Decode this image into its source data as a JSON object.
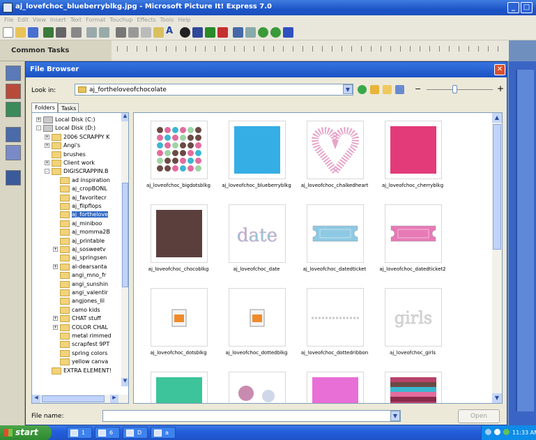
{
  "app": {
    "title": "aj_lovefchoc_blueberryblkg.jpg - Microsoft Picture It! Express 7.0",
    "menu": [
      "File",
      "Edit",
      "View",
      "Insert",
      "Text",
      "Format",
      "Touchup",
      "Effects",
      "Tools",
      "Help"
    ],
    "common_tasks": "Common Tasks"
  },
  "browser": {
    "title": "File Browser",
    "lookin_label": "Look in:",
    "lookin_value": "aj_fortheloveofchocolate",
    "tabs": [
      "Folders",
      "Tasks"
    ],
    "tree": [
      {
        "label": "Local Disk (C:)",
        "level": 0,
        "expander": "+",
        "kind": "drive"
      },
      {
        "label": "Local Disk (D:)",
        "level": 0,
        "expander": "-",
        "kind": "drive"
      },
      {
        "label": "2006 SCRAPPY K",
        "level": 1,
        "expander": "+",
        "kind": "folder"
      },
      {
        "label": "Angi's",
        "level": 1,
        "expander": "+",
        "kind": "folder"
      },
      {
        "label": "brushes",
        "level": 1,
        "expander": "",
        "kind": "folder"
      },
      {
        "label": "Client work",
        "level": 1,
        "expander": "+",
        "kind": "folder"
      },
      {
        "label": "DIGISCRAPPIN.B",
        "level": 1,
        "expander": "-",
        "kind": "folder"
      },
      {
        "label": "ad inspiration",
        "level": 2,
        "expander": "",
        "kind": "folder"
      },
      {
        "label": "aj_cropBONL",
        "level": 2,
        "expander": "",
        "kind": "folder"
      },
      {
        "label": "aj_favoritecr",
        "level": 2,
        "expander": "",
        "kind": "folder"
      },
      {
        "label": "aj_flipflops",
        "level": 2,
        "expander": "",
        "kind": "folder"
      },
      {
        "label": "aj_forthelove",
        "level": 2,
        "expander": "",
        "kind": "folder",
        "selected": true
      },
      {
        "label": "aj_miniboo",
        "level": 2,
        "expander": "",
        "kind": "folder"
      },
      {
        "label": "aj_momma2B",
        "level": 2,
        "expander": "",
        "kind": "folder"
      },
      {
        "label": "aj_printable",
        "level": 2,
        "expander": "",
        "kind": "folder"
      },
      {
        "label": "aj_sosweetv",
        "level": 2,
        "expander": "+",
        "kind": "folder"
      },
      {
        "label": "aj_springsen",
        "level": 2,
        "expander": "",
        "kind": "folder"
      },
      {
        "label": "al-dearsanta",
        "level": 2,
        "expander": "+",
        "kind": "folder"
      },
      {
        "label": "angi_mno_fr",
        "level": 2,
        "expander": "",
        "kind": "folder"
      },
      {
        "label": "angi_sunshin",
        "level": 2,
        "expander": "",
        "kind": "folder"
      },
      {
        "label": "angi_valentir",
        "level": 2,
        "expander": "",
        "kind": "folder"
      },
      {
        "label": "angjones_lil",
        "level": 2,
        "expander": "",
        "kind": "folder"
      },
      {
        "label": "camo kids",
        "level": 2,
        "expander": "",
        "kind": "folder"
      },
      {
        "label": "CHAT stuff",
        "level": 2,
        "expander": "+",
        "kind": "folder"
      },
      {
        "label": "COLOR CHAL",
        "level": 2,
        "expander": "+",
        "kind": "folder"
      },
      {
        "label": "metal rimmed",
        "level": 2,
        "expander": "",
        "kind": "folder"
      },
      {
        "label": "scrapfest 9PT",
        "level": 2,
        "expander": "",
        "kind": "folder"
      },
      {
        "label": "spring colors",
        "level": 2,
        "expander": "",
        "kind": "folder"
      },
      {
        "label": "yellow canva",
        "level": 2,
        "expander": "",
        "kind": "folder"
      },
      {
        "label": "EXTRA ELEMENT!",
        "level": 1,
        "expander": "",
        "kind": "folder"
      }
    ],
    "files": [
      {
        "name": "aj_loveofchoc_bigdotsblkg",
        "thumb": "polka",
        "color": "#6b4a45"
      },
      {
        "name": "aj_loveofchoc_blueberryblkg",
        "thumb": "solid",
        "color": "#35aee6"
      },
      {
        "name": "aj_loveofchoc_chalkedheart",
        "thumb": "heart",
        "color": "#e7a4c8"
      },
      {
        "name": "aj_loveofchoc_cherryblkg",
        "thumb": "solid",
        "color": "#e33a7a"
      },
      {
        "name": "aj_loveofchoc_chocoblkg",
        "thumb": "solid",
        "color": "#5a3f3c"
      },
      {
        "name": "aj_loveofchoc_date",
        "thumb": "date",
        "color": "#8fc8d8"
      },
      {
        "name": "aj_loveofchoc_datedticket",
        "thumb": "ticket",
        "color": "#8dc9e3"
      },
      {
        "name": "aj_loveofchoc_datedticket2",
        "thumb": "ticket",
        "color": "#e77ab6"
      },
      {
        "name": "aj_loveofchoc_dotsblkg",
        "thumb": "fileicon",
        "color": "#f08a2a"
      },
      {
        "name": "aj_loveofchoc_dottedblkg",
        "thumb": "fileicon",
        "color": "#f08a2a"
      },
      {
        "name": "aj_loveofchoc_dottedribbon",
        "thumb": "ribbon",
        "color": "#c9c9c9"
      },
      {
        "name": "aj_loveofchoc_girls",
        "thumb": "girls",
        "color": "#d9d9d9"
      },
      {
        "name": "",
        "thumb": "solid",
        "color": "#3dc49a"
      },
      {
        "name": "",
        "thumb": "circles",
        "color": "#c98ab0"
      },
      {
        "name": "",
        "thumb": "solid",
        "color": "#e86fd6"
      },
      {
        "name": "",
        "thumb": "stripes",
        "color": "#b8426a"
      }
    ],
    "filename_label": "File name:",
    "filename_value": "",
    "open_label": "Open"
  },
  "taskbar": {
    "start_label": "start",
    "tasks": [
      "1",
      "6",
      "D",
      "a"
    ],
    "clock": "11:33 AM"
  }
}
